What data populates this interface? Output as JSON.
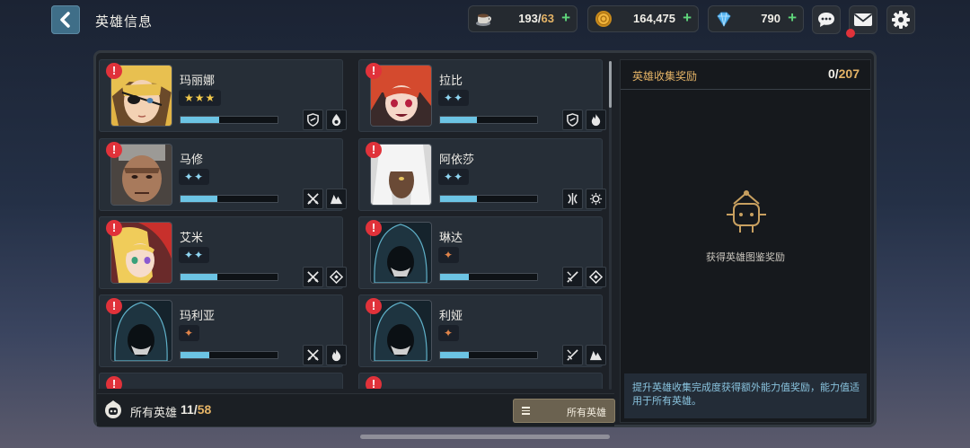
{
  "header": {
    "title": "英雄信息"
  },
  "resources": {
    "stamina": {
      "icon": "coffee-cup-icon",
      "current": "193",
      "max": "63"
    },
    "gold": {
      "icon": "gold-coin-icon",
      "value": "164,475"
    },
    "gems": {
      "icon": "diamond-icon",
      "value": "790"
    }
  },
  "heroes": [
    {
      "name": "玛丽娜",
      "stars": "★★★",
      "star_color": "#f2c94c",
      "xp": 0.4,
      "icons": [
        "shield-icon",
        "water-drop-icon"
      ]
    },
    {
      "name": "拉比",
      "stars": "✦✦",
      "star_color": "#8fd6f2",
      "xp": 0.38,
      "icons": [
        "shield-icon",
        "fire-icon"
      ]
    },
    {
      "name": "马修",
      "stars": "✦✦",
      "star_color": "#8fd6f2",
      "xp": 0.38,
      "icons": [
        "crossed-swords-icon",
        "earth-icon"
      ]
    },
    {
      "name": "阿依莎",
      "stars": "✦✦",
      "star_color": "#8fd6f2",
      "xp": 0.38,
      "icons": [
        "bow-icon",
        "light-icon"
      ]
    },
    {
      "name": "艾米",
      "stars": "✦✦",
      "star_color": "#8fd6f2",
      "xp": 0.38,
      "icons": [
        "crossed-swords-icon",
        "magic-rune-icon"
      ]
    },
    {
      "name": "琳达",
      "stars": "✦",
      "star_color": "#e0844a",
      "xp": 0.3,
      "icons": [
        "dagger-icon",
        "magic-rune-icon"
      ]
    },
    {
      "name": "玛利亚",
      "stars": "✦",
      "star_color": "#e0844a",
      "xp": 0.3,
      "icons": [
        "crossed-swords-icon",
        "fire-icon"
      ]
    },
    {
      "name": "利娅",
      "stars": "✦",
      "star_color": "#e0844a",
      "xp": 0.3,
      "icons": [
        "dagger-icon",
        "earth-icon"
      ]
    }
  ],
  "footer": {
    "owned_label": "所有英雄",
    "owned": "11",
    "total": "58",
    "filter_label": "所有英雄"
  },
  "side_panel": {
    "title": "英雄收集奖励",
    "progress_current": "0",
    "progress_total": "207",
    "empty_text": "获得英雄图鉴奖励",
    "description": "提升英雄收集完成度获得额外能力值奖励，能力值适用于所有英雄。"
  },
  "colors": {
    "accent_gold": "#e4b366",
    "accent_blue": "#89c3de",
    "alert_red": "#e0323a",
    "plus_green": "#5fd67b"
  }
}
